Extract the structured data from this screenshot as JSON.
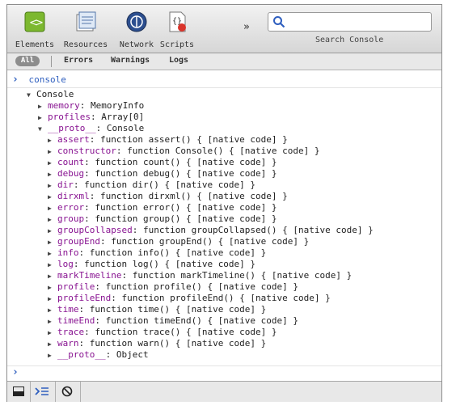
{
  "toolbar": {
    "tabs": [
      {
        "label": "Elements",
        "icon": "elements-icon"
      },
      {
        "label": "Resources",
        "icon": "resources-icon"
      },
      {
        "label": "Network",
        "icon": "network-icon"
      },
      {
        "label": "Scripts",
        "icon": "scripts-icon"
      }
    ],
    "more": "»",
    "search_caption": "Search Console",
    "search_value": ""
  },
  "filters": {
    "all": "All",
    "errors": "Errors",
    "warnings": "Warnings",
    "logs": "Logs"
  },
  "console": {
    "input_arrow": "›",
    "input": "console",
    "object_name": "Console",
    "lines": [
      {
        "key": "memory",
        "value": "MemoryInfo"
      },
      {
        "key": "profiles",
        "value": "Array[0]"
      },
      {
        "key": "__proto__",
        "value": "Console"
      },
      {
        "key": "assert",
        "value": "function assert() { [native code] }"
      },
      {
        "key": "constructor",
        "value": "function Console() { [native code] }"
      },
      {
        "key": "count",
        "value": "function count() { [native code] }"
      },
      {
        "key": "debug",
        "value": "function debug() { [native code] }"
      },
      {
        "key": "dir",
        "value": "function dir() { [native code] }"
      },
      {
        "key": "dirxml",
        "value": "function dirxml() { [native code] }"
      },
      {
        "key": "error",
        "value": "function error() { [native code] }"
      },
      {
        "key": "group",
        "value": "function group() { [native code] }"
      },
      {
        "key": "groupCollapsed",
        "value": "function groupCollapsed() { [native code] }"
      },
      {
        "key": "groupEnd",
        "value": "function groupEnd() { [native code] }"
      },
      {
        "key": "info",
        "value": "function info() { [native code] }"
      },
      {
        "key": "log",
        "value": "function log() { [native code] }"
      },
      {
        "key": "markTimeline",
        "value": "function markTimeline() { [native code] }"
      },
      {
        "key": "profile",
        "value": "function profile() { [native code] }"
      },
      {
        "key": "profileEnd",
        "value": "function profileEnd() { [native code] }"
      },
      {
        "key": "time",
        "value": "function time() { [native code] }"
      },
      {
        "key": "timeEnd",
        "value": "function timeEnd() { [native code] }"
      },
      {
        "key": "trace",
        "value": "function trace() { [native code] }"
      },
      {
        "key": "warn",
        "value": "function warn() { [native code] }"
      },
      {
        "key": "__proto__",
        "value": "Object"
      }
    ],
    "prompt": "›"
  },
  "bottom": {
    "icons": [
      "dock-icon",
      "console-drawer-icon",
      "clear-console-icon"
    ]
  },
  "colors": {
    "property_key": "#881391",
    "prompt_blue": "#2f5fbf"
  }
}
